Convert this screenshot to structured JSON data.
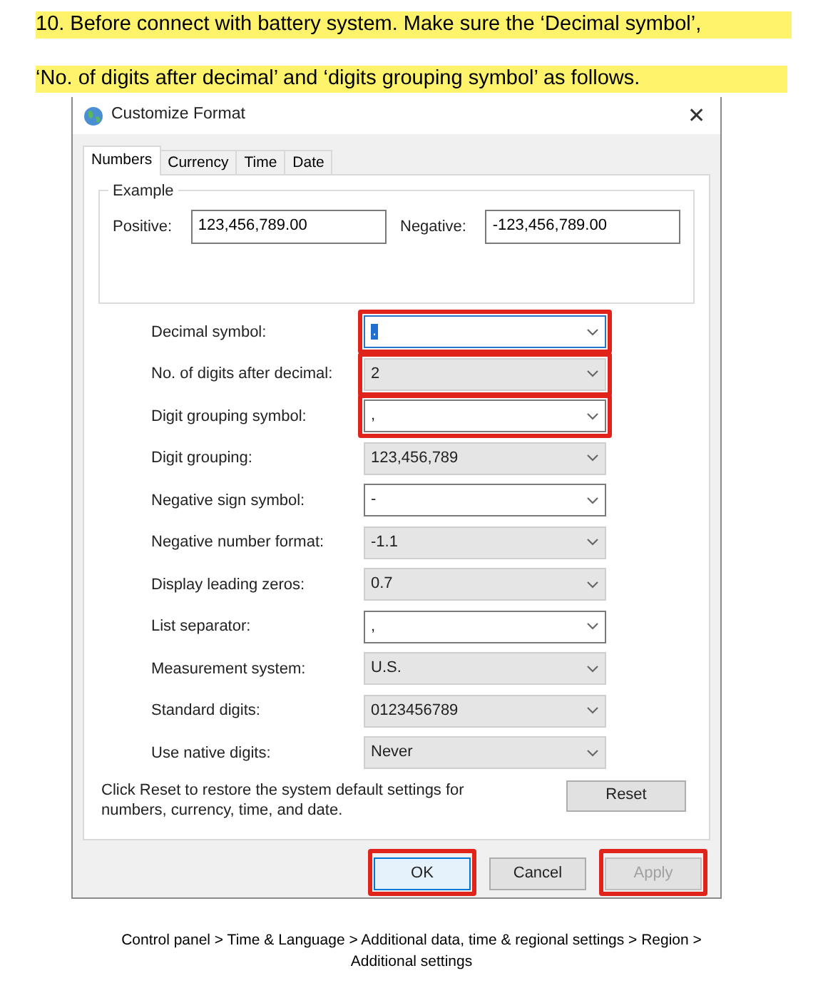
{
  "instruction": [
    "10.  Before connect with battery system. Make sure the ‘Decimal symbol’,",
    "‘No. of digits after decimal’ and ‘digits grouping symbol’ as follows."
  ],
  "window": {
    "title": "Customize Format",
    "close": "✕"
  },
  "tabs": [
    {
      "label": "Numbers",
      "selected": true
    },
    {
      "label": "Currency",
      "selected": false
    },
    {
      "label": "Time",
      "selected": false
    },
    {
      "label": "Date",
      "selected": false
    }
  ],
  "example": {
    "title": "Example",
    "positive_label": "Positive:",
    "positive": "123,456,789.00",
    "negative_label": "Negative:",
    "negative": "-123,456,789.00"
  },
  "settings": [
    {
      "label": "Decimal symbol:",
      "value": ".",
      "editable": true,
      "focused": true,
      "highlighted": true
    },
    {
      "label": "No. of digits after decimal:",
      "value": "2",
      "editable": false,
      "focused": false,
      "highlighted": true
    },
    {
      "label": "Digit grouping symbol:",
      "value": ",",
      "editable": true,
      "focused": false,
      "highlighted": true
    },
    {
      "label": "Digit grouping:",
      "value": "123,456,789",
      "editable": false,
      "focused": false,
      "highlighted": false
    },
    {
      "label": "Negative sign symbol:",
      "value": "-",
      "editable": true,
      "focused": false,
      "highlighted": false
    },
    {
      "label": "Negative number format:",
      "value": "-1.1",
      "editable": false,
      "focused": false,
      "highlighted": false
    },
    {
      "label": "Display leading zeros:",
      "value": "0.7",
      "editable": false,
      "focused": false,
      "highlighted": false
    },
    {
      "label": "List separator:",
      "value": ",",
      "editable": true,
      "focused": false,
      "highlighted": false
    },
    {
      "label": "Measurement system:",
      "value": "U.S.",
      "editable": false,
      "focused": false,
      "highlighted": false
    },
    {
      "label": "Standard digits:",
      "value": "0123456789",
      "editable": false,
      "focused": false,
      "highlighted": false
    },
    {
      "label": "Use native digits:",
      "value": "Never",
      "editable": false,
      "focused": false,
      "highlighted": false
    }
  ],
  "reset_note": "Click Reset to restore the system default settings for numbers, currency, time, and date.",
  "reset_button": "Reset",
  "buttons": [
    {
      "label": "OK",
      "default": true,
      "disabled": false,
      "highlighted": true
    },
    {
      "label": "Cancel",
      "default": false,
      "disabled": false,
      "highlighted": false
    },
    {
      "label": "Apply",
      "default": false,
      "disabled": true,
      "highlighted": true
    }
  ],
  "caption": [
    "Control panel > Time & Language > Additional data, time & regional settings > Region >",
    "Additional settings"
  ]
}
